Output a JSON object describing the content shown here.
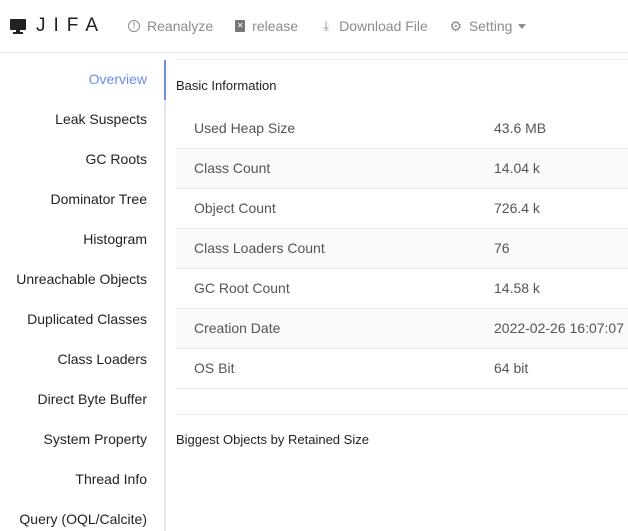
{
  "header": {
    "logo_text": "JIFA",
    "logo_icon": "desktop-icon",
    "nav": [
      {
        "label": "Reanalyze",
        "icon": "info-circle-icon"
      },
      {
        "label": "release",
        "icon": "release-icon"
      },
      {
        "label": "Download File",
        "icon": "download-icon"
      },
      {
        "label": "Setting",
        "icon": "gear-icon",
        "dropdown": true
      }
    ]
  },
  "sidebar": {
    "active": "Overview",
    "items": [
      {
        "label": "Overview"
      },
      {
        "label": "Leak Suspects"
      },
      {
        "label": "GC Roots"
      },
      {
        "label": "Dominator Tree"
      },
      {
        "label": "Histogram"
      },
      {
        "label": "Unreachable Objects"
      },
      {
        "label": "Duplicated Classes"
      },
      {
        "label": "Class Loaders"
      },
      {
        "label": "Direct Byte Buffer"
      },
      {
        "label": "System Property"
      },
      {
        "label": "Thread Info"
      },
      {
        "label": "Query (OQL/Calcite)"
      }
    ]
  },
  "main": {
    "basic_info_title": "Basic Information",
    "basic_info": [
      {
        "key": "Used Heap Size",
        "value": "43.6 MB"
      },
      {
        "key": "Class Count",
        "value": "14.04 k"
      },
      {
        "key": "Object Count",
        "value": "726.4 k"
      },
      {
        "key": "Class Loaders Count",
        "value": "76"
      },
      {
        "key": "GC Root Count",
        "value": "14.58 k"
      },
      {
        "key": "Creation Date",
        "value": "2022-02-26 16:07:07"
      },
      {
        "key": "OS Bit",
        "value": "64 bit"
      }
    ],
    "biggest_objects_title": "Biggest Objects by Retained Size"
  },
  "colors": {
    "accent": "#6b8cf0",
    "nav_text": "#8c8c8c",
    "row_alt_bg": "#fafafa"
  }
}
